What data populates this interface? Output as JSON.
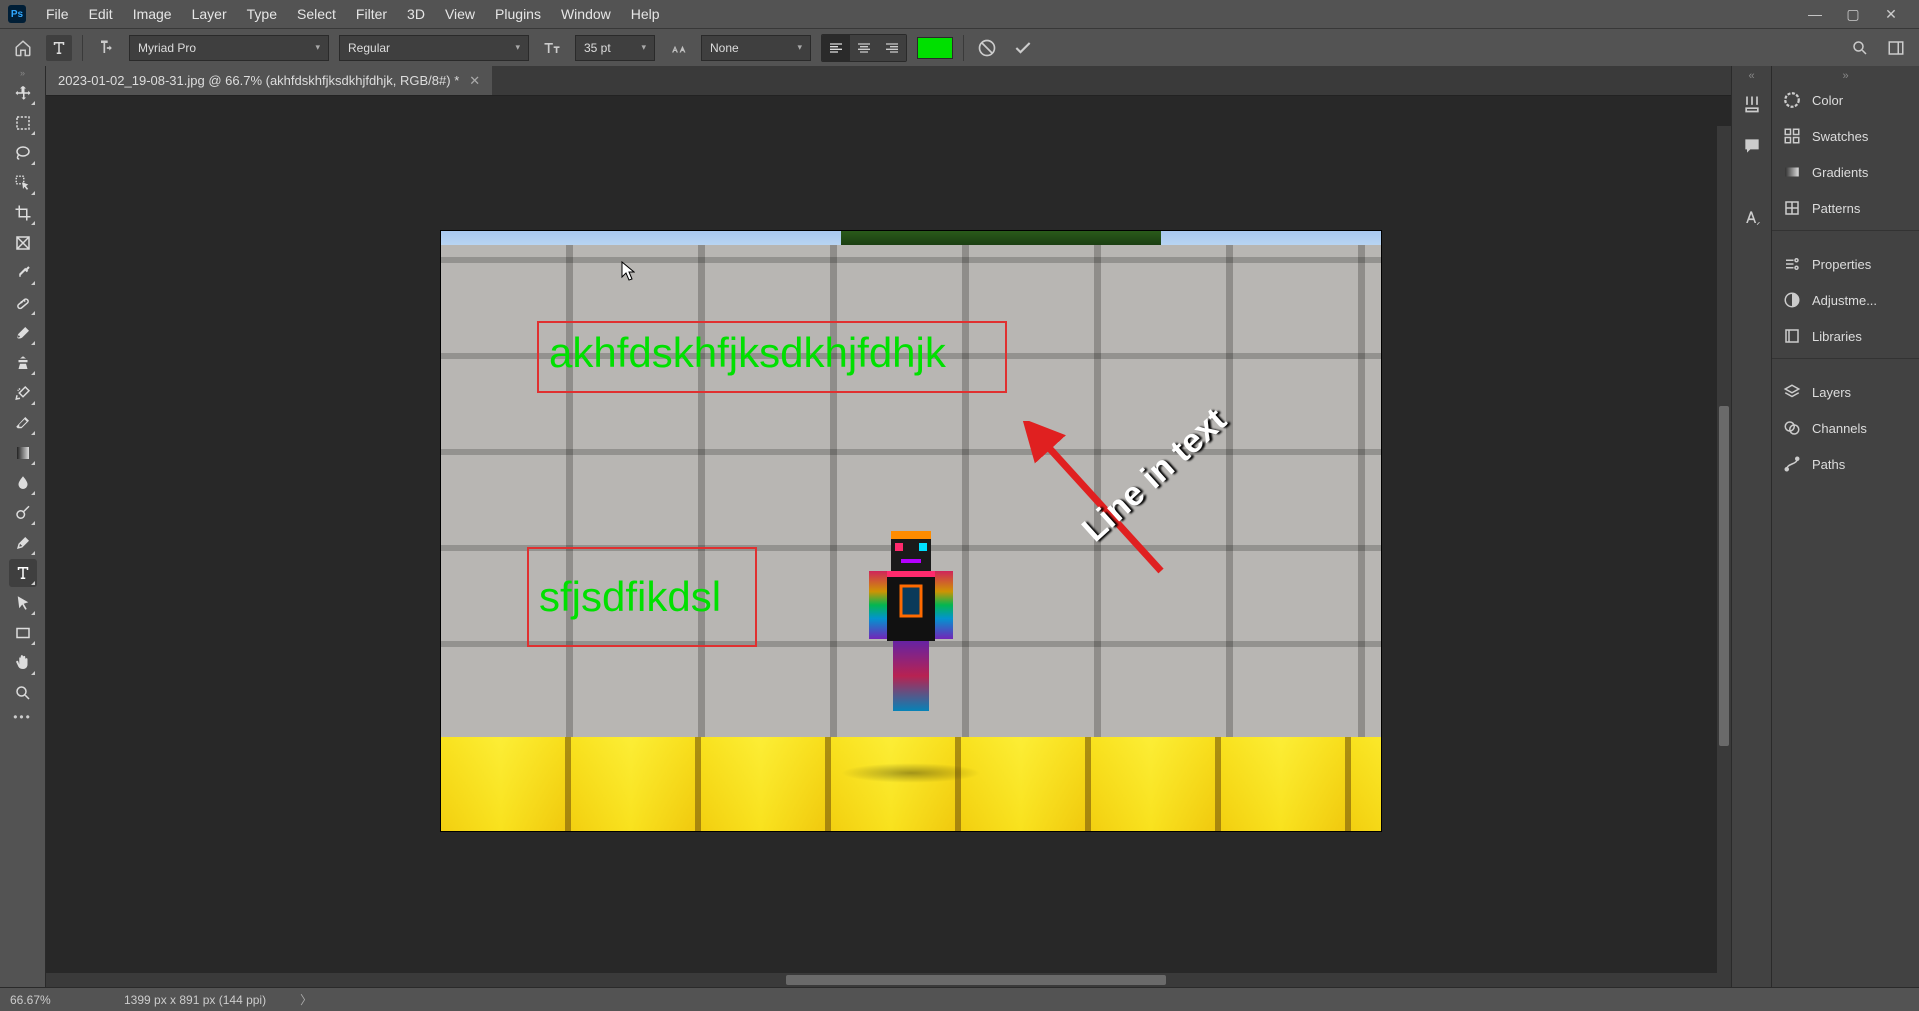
{
  "menu": [
    "File",
    "Edit",
    "Image",
    "Layer",
    "Type",
    "Select",
    "Filter",
    "3D",
    "View",
    "Plugins",
    "Window",
    "Help"
  ],
  "options": {
    "font_family": "Myriad Pro",
    "font_weight": "Regular",
    "font_size": "35 pt",
    "anti_alias": "None",
    "text_color": "#00e000"
  },
  "document": {
    "tab_title": "2023-01-02_19-08-31.jpg @ 66.7% (akhfdskhfjksdkhjfdhjk, RGB/8#) *",
    "text1": "akhfdskhfjksdkhjfdhjk",
    "text2": "sfjsdfikdsl",
    "annotation": "Line in text"
  },
  "right_panels": {
    "group1": [
      "Color",
      "Swatches",
      "Gradients",
      "Patterns"
    ],
    "group2": [
      "Properties",
      "Adjustme...",
      "Libraries"
    ],
    "group3": [
      "Layers",
      "Channels",
      "Paths"
    ]
  },
  "status": {
    "zoom": "66.67%",
    "doc_info": "1399 px x 891 px (144 ppi)"
  }
}
